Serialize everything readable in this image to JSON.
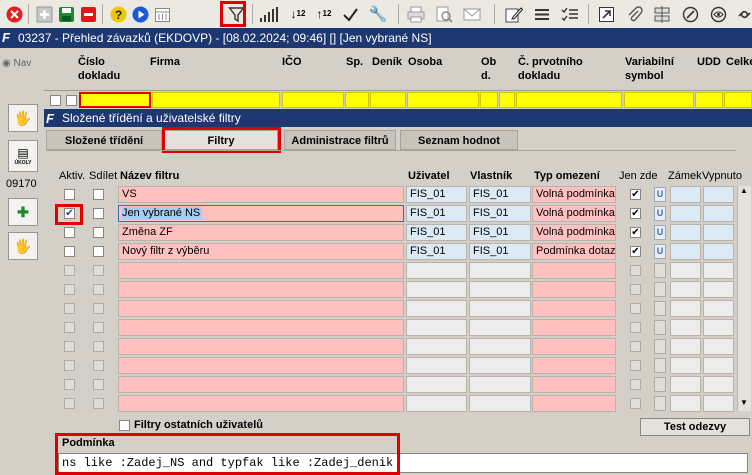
{
  "toolbar": {
    "buttons": [
      "close-icon",
      "add-icon",
      "save-icon",
      "delete-icon",
      "help-icon",
      "play-icon",
      "calendar-icon",
      "filter-icon",
      "signal-icon",
      "sort-asc-icon",
      "sort-desc-icon",
      "check-icon",
      "wrench-icon",
      "print-icon",
      "print-preview-icon",
      "mail-icon",
      "edit-icon",
      "list-icon",
      "checklist-icon",
      "export-icon",
      "attach-icon",
      "split-icon",
      "pen-icon",
      "eye-icon",
      "link-icon"
    ]
  },
  "window": {
    "title": "03237 - Přehled závazků (EKDOVP) - [08.02.2024; 09:46] [] [Jen vybrané NS]"
  },
  "nav": {
    "label": "Nav",
    "number": "09170",
    "ukoly": "ÚKOLY"
  },
  "grid": {
    "columns": [
      "Číslo dokladu",
      "Firma",
      "IČO",
      "Sp.",
      "Deník",
      "Osoba",
      "Ob d.",
      "Č. prvotního dokladu",
      "Variabilní symbol",
      "UDD",
      "Celke"
    ]
  },
  "panel": {
    "title": "Složené třídění a uživatelské filtry",
    "tabs": [
      "Složené třídění",
      "Filtry",
      "Administrace filtrů",
      "Seznam hodnot"
    ],
    "headers": {
      "aktiv": "Aktiv.",
      "sdilet": "Sdílet",
      "nazev": "Název filtru",
      "uzivatel": "Uživatel",
      "vlastnik": "Vlastník",
      "typ": "Typ omezení",
      "jenzde": "Jen zde",
      "zamek": "Zámek",
      "vypnuto": "Vypnuto"
    },
    "rows": [
      {
        "aktiv": false,
        "nazev": "VS",
        "uzivatel": "FIS_01",
        "vlastnik": "FIS_01",
        "typ": "Volná podmínka",
        "jenzde": true
      },
      {
        "aktiv": true,
        "nazev": "Jen vybrané NS",
        "uzivatel": "FIS_01",
        "vlastnik": "FIS_01",
        "typ": "Volná podmínka",
        "jenzde": true
      },
      {
        "aktiv": false,
        "nazev": "Změna ZF",
        "uzivatel": "FIS_01",
        "vlastnik": "FIS_01",
        "typ": "Volná podmínka",
        "jenzde": true
      },
      {
        "aktiv": false,
        "nazev": "Nový filtr z výběru",
        "uzivatel": "FIS_01",
        "vlastnik": "FIS_01",
        "typ": "Podmínka dotazu",
        "jenzde": true
      }
    ],
    "lock_label": "U",
    "other_users": "Filtry ostatních uživatelů",
    "test_button": "Test odezvy",
    "condition_label": "Podmínka",
    "condition_value": "ns like :Zadej_NS and typfak like :Zadej_denik"
  }
}
